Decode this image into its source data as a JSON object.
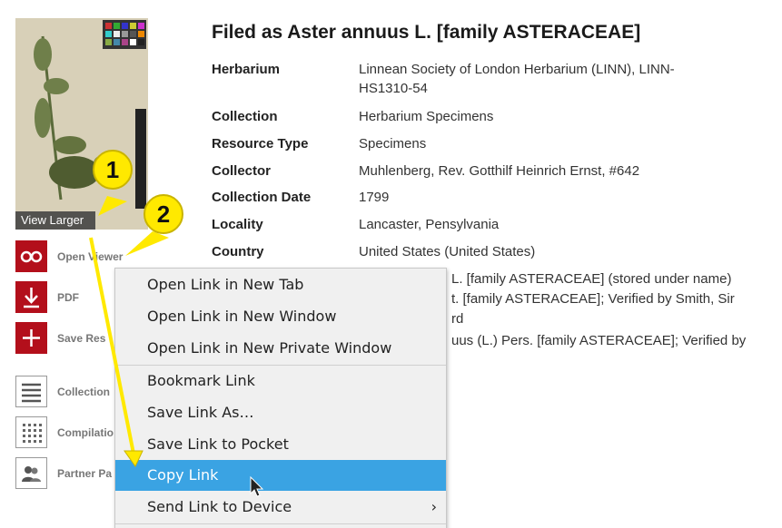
{
  "thumbnail": {
    "view_larger_label": "View Larger"
  },
  "record": {
    "title": "Filed as Aster annuus L. [family ASTERACEAE]",
    "fields": [
      {
        "label": "Herbarium",
        "value": "Linnean Society of London Herbarium (LINN), LINN-HS1310-54"
      },
      {
        "label": "Collection",
        "value": "Herbarium Specimens"
      },
      {
        "label": "Resource Type",
        "value": "Specimens"
      },
      {
        "label": "Collector",
        "value": "Muhlenberg, Rev. Gotthilf Heinrich Ernst, #642"
      },
      {
        "label": "Collection Date",
        "value": "1799"
      },
      {
        "label": "Locality",
        "value": "Lancaster, Pensylvania"
      },
      {
        "label": "Country",
        "value": "United States (United States)"
      }
    ],
    "partial_lines": [
      "L. [family ASTERACEAE] (stored under name)",
      "t. [family ASTERACEAE]; Verified by Smith, Sir",
      "rd",
      "uus (L.) Pers. [family ASTERACEAE]; Verified by"
    ]
  },
  "sidebar": {
    "items": [
      {
        "label": "Open Viewer",
        "icon": "glasses-icon"
      },
      {
        "label": "PDF",
        "icon": "download-icon"
      },
      {
        "label": "Save Res",
        "icon": "plus-icon"
      },
      {
        "label": "Collection",
        "icon": "list-icon"
      },
      {
        "label": "Compilatio",
        "icon": "grid-icon"
      },
      {
        "label": "Partner Pa",
        "icon": "people-icon"
      }
    ]
  },
  "context_menu": {
    "items": [
      "Open Link in New Tab",
      "Open Link in New Window",
      "Open Link in New Private Window",
      "Bookmark Link",
      "Save Link As…",
      "Save Link to Pocket",
      "Copy Link",
      "Send Link to Device"
    ],
    "highlighted": "Copy Link",
    "submenu_arrow": "›"
  },
  "callouts": [
    "1",
    "2"
  ],
  "colors": {
    "accent_red": "#b30f1b",
    "menu_highlight": "#3aa3e3",
    "callout_yellow": "#ffe900"
  }
}
